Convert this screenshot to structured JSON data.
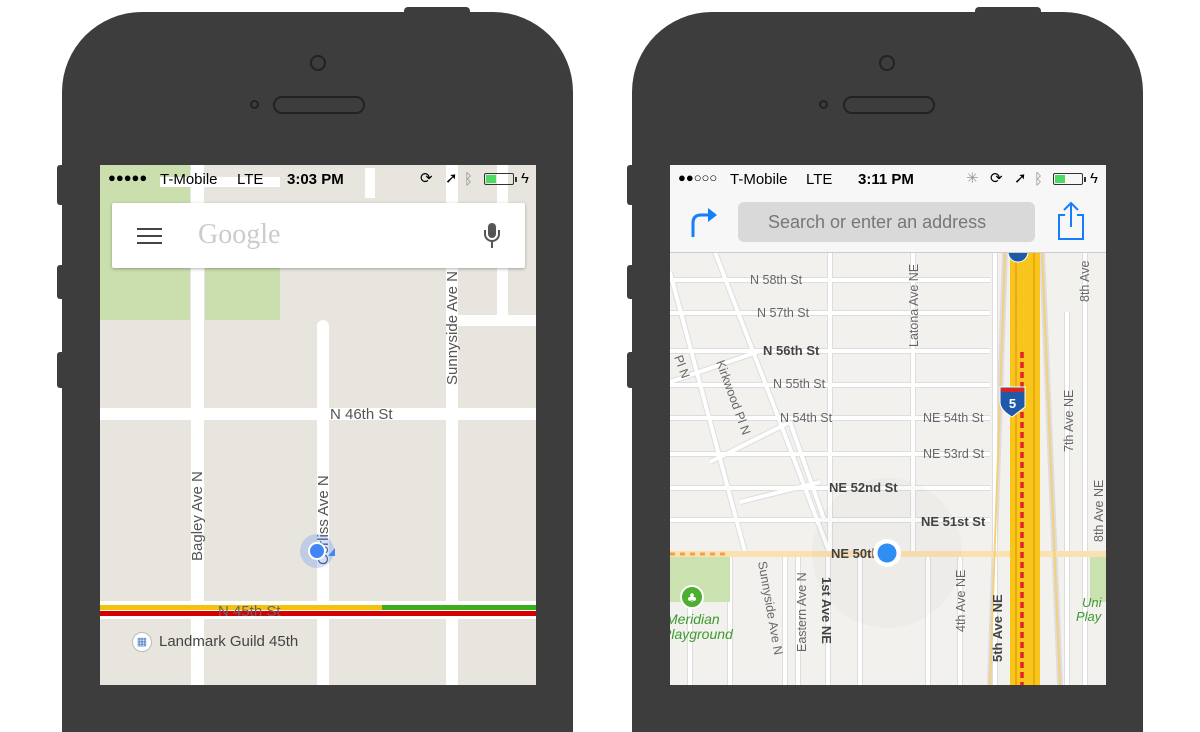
{
  "left_phone": {
    "status": {
      "signal_dots": "●●●●●",
      "carrier": "T-Mobile",
      "network": "LTE",
      "time": "3:03 PM",
      "battery_level": 0.35
    },
    "search": {
      "menu_icon": "hamburger-icon",
      "placeholder": "Google",
      "mic_icon": "microphone-icon"
    },
    "map": {
      "streets": [
        "N 46th St",
        "N 45th St",
        "Bagley Ave N",
        "Corliss Ave N",
        "Sunnyside Ave N"
      ],
      "poi": "Landmark Guild 45th",
      "traffic_colors": {
        "heavy": "#d50000",
        "slow": "#f4c20d",
        "free": "#3cae1e"
      }
    }
  },
  "right_phone": {
    "status": {
      "signal_dots": "●●○○○",
      "carrier": "T-Mobile",
      "network": "LTE",
      "time": "3:11 PM",
      "battery_level": 0.35
    },
    "toolbar": {
      "directions_icon": "directions-arrow-icon",
      "search_placeholder": "Search or enter an address",
      "share_icon": "share-icon"
    },
    "map": {
      "streets": [
        "N 58th St",
        "N 57th St",
        "N 56th St",
        "N 55th St",
        "N 54th St",
        "NE 54th St",
        "NE 53rd St",
        "NE 52nd St",
        "NE 51st St",
        "NE 50th St",
        "Latona Ave NE",
        "Kirkwood Pl N",
        "Sunnyside Ave N",
        "Eastern Ave N",
        "1st Ave NE",
        "4th Ave NE",
        "5th Ave NE",
        "7th Ave NE",
        "8th Ave NE",
        "8th Ave",
        "Pl N"
      ],
      "highway_shield": "5",
      "parks": [
        "Meridian",
        "Playground",
        "Uni",
        "Play"
      ]
    }
  },
  "colors": {
    "accent_blue": "#147efb",
    "location_dot": "#4285f4",
    "phone_body": "#3d3d3d"
  }
}
